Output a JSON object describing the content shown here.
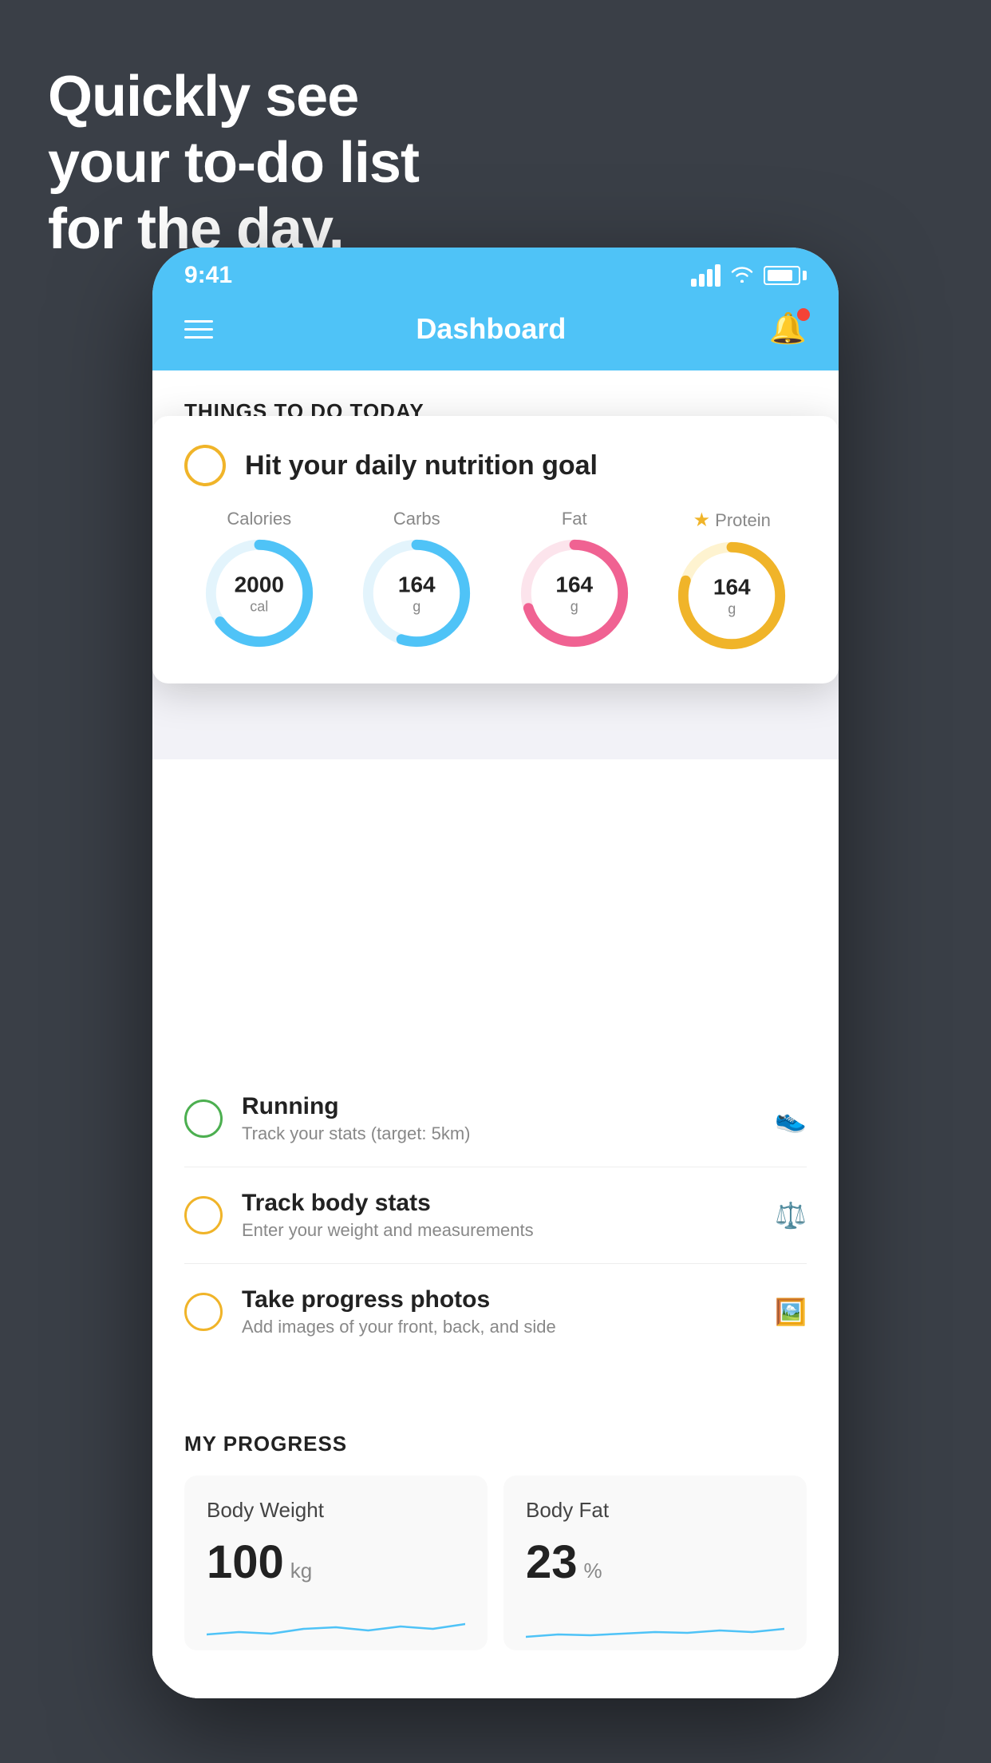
{
  "hero": {
    "line1": "Quickly see",
    "line2": "your to-do list",
    "line3": "for the day."
  },
  "statusBar": {
    "time": "9:41"
  },
  "header": {
    "title": "Dashboard"
  },
  "sectionHeader": "THINGS TO DO TODAY",
  "nutritionCard": {
    "title": "Hit your daily nutrition goal",
    "macros": [
      {
        "label": "Calories",
        "value": "2000",
        "unit": "cal",
        "color": "#4fc3f7",
        "trackColor": "#e3f4fc",
        "percent": 65,
        "starred": false
      },
      {
        "label": "Carbs",
        "value": "164",
        "unit": "g",
        "color": "#4fc3f7",
        "trackColor": "#e3f4fc",
        "percent": 55,
        "starred": false
      },
      {
        "label": "Fat",
        "value": "164",
        "unit": "g",
        "color": "#f06292",
        "trackColor": "#fce4ec",
        "percent": 70,
        "starred": false
      },
      {
        "label": "Protein",
        "value": "164",
        "unit": "g",
        "color": "#f0b429",
        "trackColor": "#fef3d0",
        "percent": 80,
        "starred": true
      }
    ]
  },
  "todoItems": [
    {
      "title": "Running",
      "subtitle": "Track your stats (target: 5km)",
      "circleColor": "green",
      "icon": "👟"
    },
    {
      "title": "Track body stats",
      "subtitle": "Enter your weight and measurements",
      "circleColor": "yellow",
      "icon": "⚖️"
    },
    {
      "title": "Take progress photos",
      "subtitle": "Add images of your front, back, and side",
      "circleColor": "yellow",
      "icon": "🖼️"
    }
  ],
  "progressSection": {
    "title": "MY PROGRESS",
    "cards": [
      {
        "title": "Body Weight",
        "value": "100",
        "unit": "kg"
      },
      {
        "title": "Body Fat",
        "value": "23",
        "unit": "%"
      }
    ]
  }
}
